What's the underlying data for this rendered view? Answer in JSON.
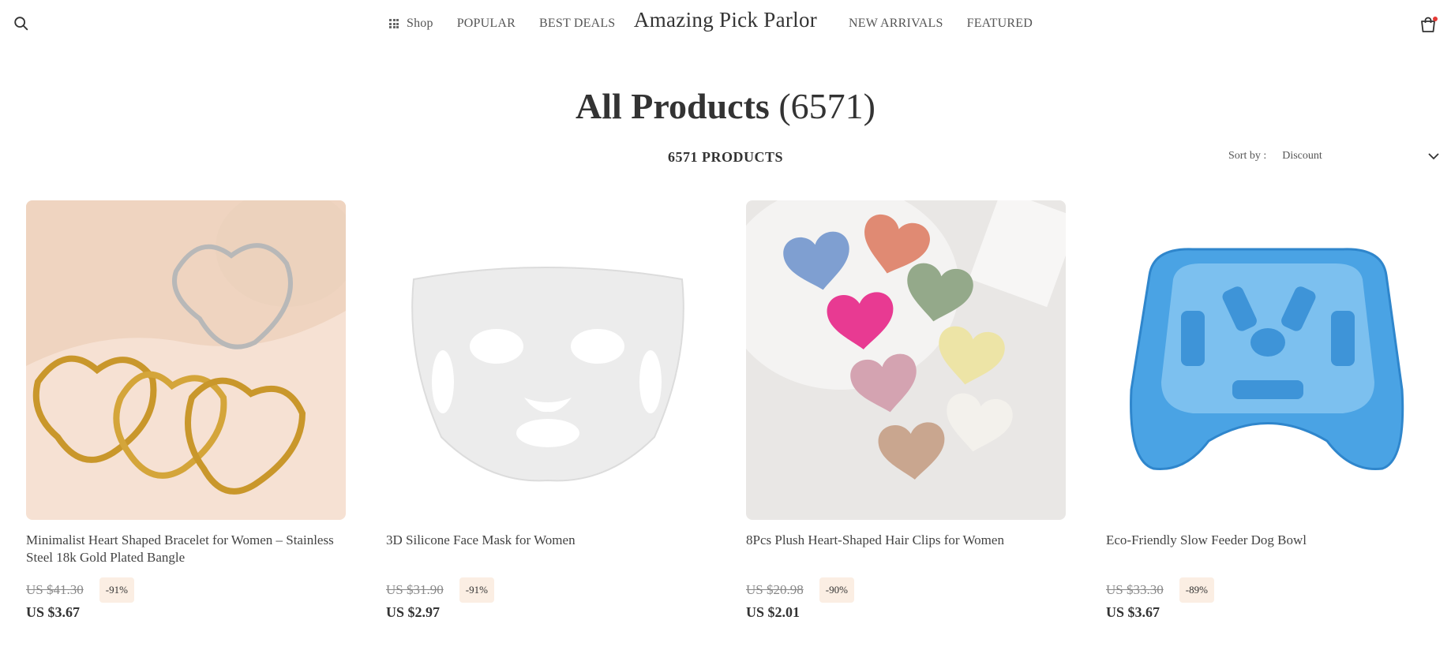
{
  "header": {
    "brand": "Amazing Pick Parlor",
    "nav_left": [
      {
        "label": "Shop",
        "icon": "grid-icon"
      },
      {
        "label": "POPULAR"
      },
      {
        "label": "BEST DEALS"
      }
    ],
    "nav_right": [
      {
        "label": "NEW ARRIVALS"
      },
      {
        "label": "FEATURED"
      }
    ],
    "search_icon": "search-icon",
    "cart_icon": "shopping-bag-icon",
    "cart_badge_color": "#e53935"
  },
  "page": {
    "title_main": "All Products",
    "title_count": "(6571)",
    "products_count": "6571 PRODUCTS",
    "sort_label": "Sort by :",
    "sort_value": "Discount"
  },
  "products": [
    {
      "title": "Minimalist Heart Shaped Bracelet for Women – Stainless Steel 18k Gold Plated Bangle",
      "old_price": "US $41.30",
      "discount": "-91%",
      "price": "US $3.67",
      "image": "gold-heart-bangles-image"
    },
    {
      "title": "3D Silicone Face Mask for Women",
      "old_price": "US $31.90",
      "discount": "-91%",
      "price": "US $2.97",
      "image": "silicone-face-mask-image"
    },
    {
      "title": "8Pcs Plush Heart-Shaped Hair Clips for Women",
      "old_price": "US $20.98",
      "discount": "-90%",
      "price": "US $2.01",
      "image": "plush-heart-hair-clips-image"
    },
    {
      "title": "Eco-Friendly Slow Feeder Dog Bowl",
      "old_price": "US $33.30",
      "discount": "-89%",
      "price": "US $3.67",
      "image": "blue-slow-feeder-bowl-image"
    }
  ],
  "colors": {
    "badge_bg": "#fbeee3",
    "text": "#333333"
  }
}
